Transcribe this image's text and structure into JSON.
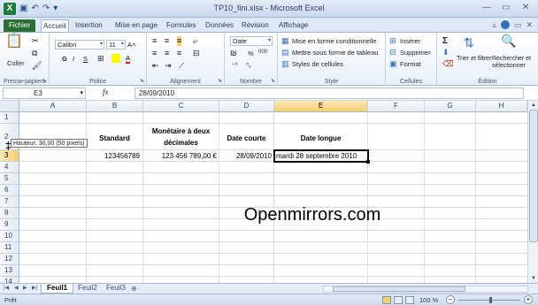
{
  "window": {
    "title": "TP10_fini.xlsx - Microsoft Excel",
    "app_icon": "X",
    "controls": {
      "minimize": "—",
      "restore": "▭",
      "close": "✕"
    }
  },
  "ribbon_tabs": [
    "Fichier",
    "Accueil",
    "Insertion",
    "Mise en page",
    "Formules",
    "Données",
    "Révision",
    "Affichage"
  ],
  "active_tab": "Accueil",
  "ribbon": {
    "clipboard": {
      "paste": "Coller",
      "label": "Presse-papiers"
    },
    "font": {
      "name": "Calibri",
      "size": "11",
      "label": "Police",
      "bold": "G",
      "italic": "I",
      "underline": "S",
      "grow": "A˄",
      "shrink": "A˅",
      "fill_color": "#ffff00",
      "font_color": "#ff0000"
    },
    "alignment": {
      "label": "Alignement"
    },
    "number": {
      "format": "Date",
      "percent": "%",
      "thousands": "000",
      "label": "Nombre"
    },
    "styles": {
      "conditional": "Mise en forme conditionnelle",
      "table": "Mettre sous forme de tableau",
      "cell_styles": "Styles de cellules",
      "label": "Style"
    },
    "cells": {
      "insert": "Insérer",
      "delete": "Supprimer",
      "format": "Format",
      "label": "Cellules"
    },
    "editing": {
      "sum": "Σ",
      "sort": "Trier et filtrer",
      "find": "Rechercher et sélectionner",
      "label": "Édition"
    }
  },
  "formula_bar": {
    "name_box": "E3",
    "fx": "fx",
    "content": "28/09/2010"
  },
  "columns": [
    "A",
    "B",
    "C",
    "D",
    "E",
    "F",
    "G",
    "H"
  ],
  "rows": [
    "1",
    "2",
    "3",
    "4",
    "5",
    "6",
    "7",
    "8",
    "9",
    "10",
    "11",
    "12",
    "13",
    "14"
  ],
  "headers": {
    "standard": "Standard",
    "monetary_line1": "Monétaire à deux",
    "monetary_line2": "décimales",
    "short_date": "Date courte",
    "long_date": "Date longue"
  },
  "values": {
    "standard": "123456789",
    "monetary": "123 456 789,00 €",
    "short_date": "28/09/2010",
    "long_date": "mardi 28 septembre 2010"
  },
  "tooltip": "Hauteur: 30,00 (50 pixels)",
  "watermark": "Openmirrors.com",
  "sheets": [
    "Feuil1",
    "Feuil2",
    "Feuil3"
  ],
  "active_sheet": "Feuil1",
  "status": {
    "mode": "Prêt",
    "zoom": "100 %"
  }
}
